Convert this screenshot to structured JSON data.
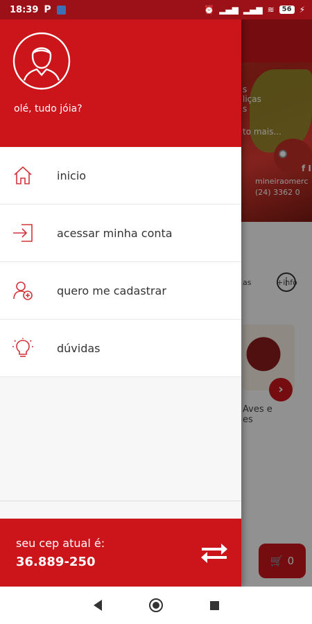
{
  "status_bar": {
    "time": "18:39",
    "p_label": "P",
    "battery": "56"
  },
  "background": {
    "banner_line1": "s",
    "banner_line2": "liças",
    "banner_line3": "s",
    "banner_more": "to mais...",
    "social": "f I",
    "handle": "mineiraomerc",
    "phone": "(24) 3362 0",
    "tab_label": "as",
    "info_label": "+info",
    "category_line1": "Aves e",
    "category_line2": "es",
    "cart_count": "0"
  },
  "drawer": {
    "greeting": "olé, tudo jóia?",
    "menu": [
      {
        "label": "inicio",
        "icon": "home-icon"
      },
      {
        "label": "acessar minha conta",
        "icon": "login-icon"
      },
      {
        "label": "quero me cadastrar",
        "icon": "add-user-icon"
      },
      {
        "label": "dúvidas",
        "icon": "lightbulb-icon"
      }
    ],
    "cep_label": "seu cep atual é:",
    "cep_value": "36.889-250"
  },
  "colors": {
    "primary": "#cc141b",
    "status_bar": "#9c1117",
    "icon": "#d4343a"
  }
}
